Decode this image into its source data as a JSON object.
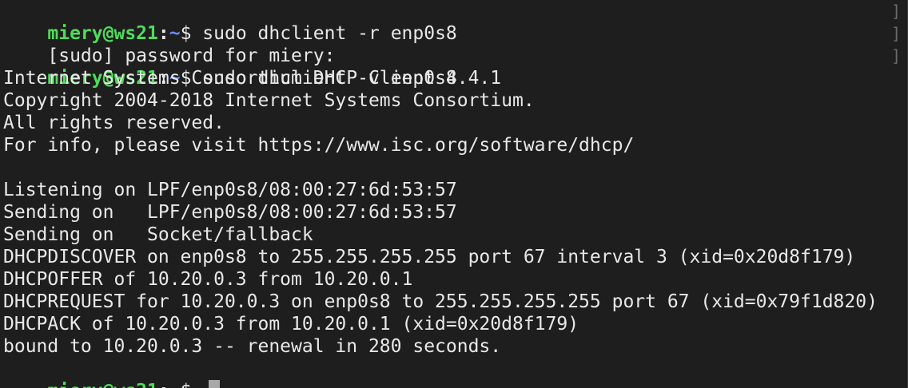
{
  "prompt": {
    "user_host": "miery@ws21",
    "colon": ":",
    "path": "~",
    "symbol": "$ "
  },
  "lines": {
    "l0_cmd": "sudo dhclient -r enp0s8",
    "l1_text": "[sudo] password for miery:",
    "l2_cmd": "sudo dhclient -v enp0s8",
    "l3": "Internet Systems Consortium DHCP Client 4.4.1",
    "l4": "Copyright 2004-2018 Internet Systems Consortium.",
    "l5": "All rights reserved.",
    "l6": "For info, please visit https://www.isc.org/software/dhcp/",
    "l7": "",
    "l8": "Listening on LPF/enp0s8/08:00:27:6d:53:57",
    "l9": "Sending on   LPF/enp0s8/08:00:27:6d:53:57",
    "l10": "Sending on   Socket/fallback",
    "l11": "DHCPDISCOVER on enp0s8 to 255.255.255.255 port 67 interval 3 (xid=0x20d8f179)",
    "l12": "DHCPOFFER of 10.20.0.3 from 10.20.0.1",
    "l13": "DHCPREQUEST for 10.20.0.3 on enp0s8 to 255.255.255.255 port 67 (xid=0x79f1d820)",
    "l14": "DHCPACK of 10.20.0.3 from 10.20.0.1 (xid=0x20d8f179)",
    "l15": "bound to 10.20.0.3 -- renewal in 280 seconds."
  },
  "edge_marks": {
    "right_bracket": "]"
  },
  "colors": {
    "background": "#1e1e1e",
    "foreground": "#e8e8e8",
    "user_host": "#4fdc5b",
    "path": "#6e8cff",
    "cursor": "#a8a8a8"
  }
}
